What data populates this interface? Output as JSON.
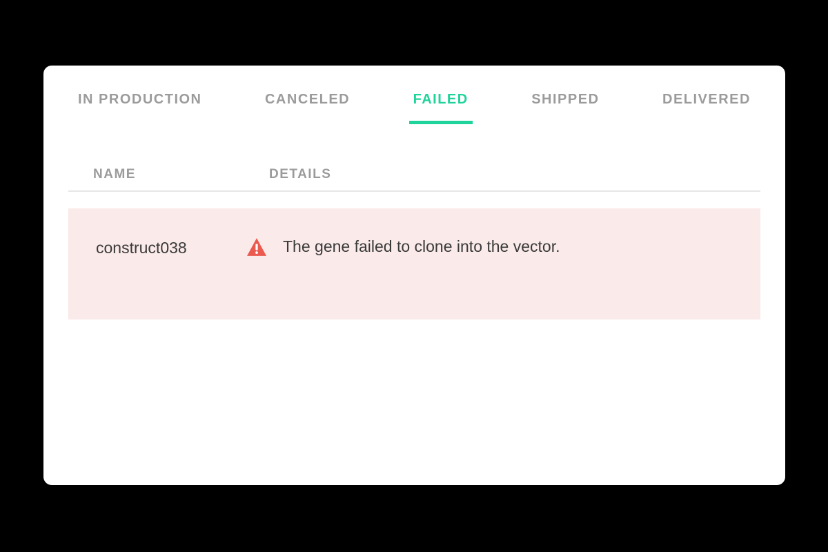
{
  "tabs": [
    {
      "label": "IN PRODUCTION",
      "active": false
    },
    {
      "label": "CANCELED",
      "active": false
    },
    {
      "label": "FAILED",
      "active": true
    },
    {
      "label": "SHIPPED",
      "active": false
    },
    {
      "label": "DELIVERED",
      "active": false
    }
  ],
  "columns": {
    "name": "NAME",
    "details": "DETAILS"
  },
  "rows": [
    {
      "name": "construct038",
      "message": "The gene failed to clone into the vector."
    }
  ],
  "colors": {
    "accent": "#1fd49a",
    "rowBg": "#faeae9",
    "warn": "#ea5a4f"
  }
}
